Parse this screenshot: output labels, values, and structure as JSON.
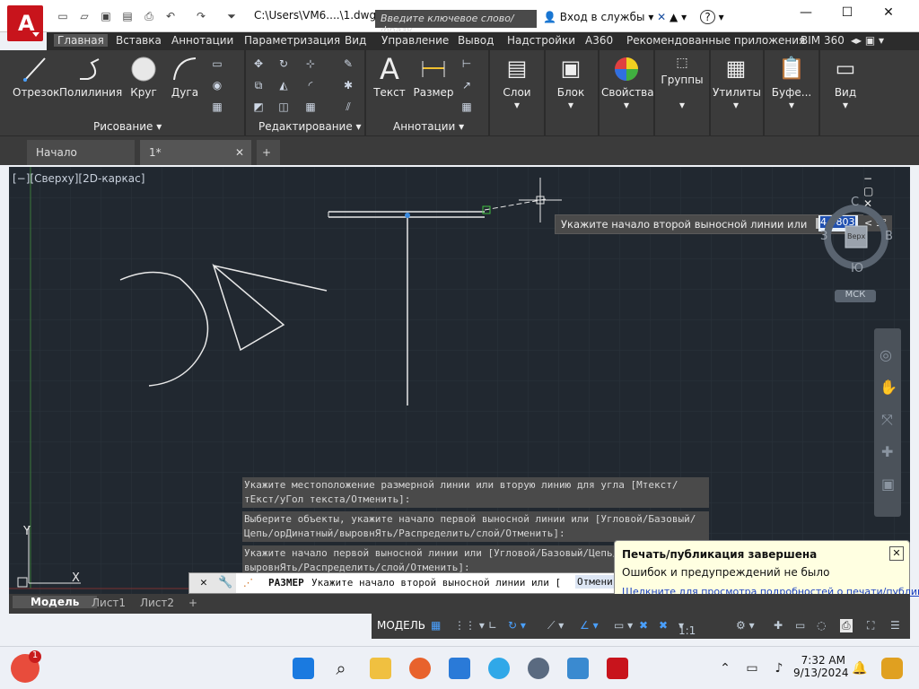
{
  "title_bar": {
    "doc_path": "C:\\Users\\VM6....\\1.dwg",
    "search_placeholder": "Введите ключевое слово/фразу",
    "services_label": "Вход в службы",
    "help_label": "?",
    "minimize": "—",
    "maximize": "☐",
    "close": "✕"
  },
  "ribbon_tabs": [
    "Главная",
    "Вставка",
    "Аннотации",
    "Параметризация",
    "Вид",
    "Управление",
    "Вывод",
    "Надстройки",
    "A360",
    "Рекомендованные приложения",
    "BIM 360"
  ],
  "ribbon": {
    "draw_buttons": [
      "Отрезок",
      "Полилиния",
      "Круг",
      "Дуга"
    ],
    "draw_panel": "Рисование",
    "modify_panel": "Редактирование",
    "annot_buttons": [
      "Текст",
      "Размер"
    ],
    "annot_panel": "Аннотации",
    "big_buttons": [
      "Слои",
      "Блок",
      "Свойства",
      "Группы",
      "Утилиты",
      "Буфе...",
      "Вид"
    ]
  },
  "file_tabs": {
    "start": "Начало",
    "doc": "1*",
    "add": "+"
  },
  "viewport": {
    "label": "[−][Сверху][2D-каркас]",
    "controls": "− ▢ ✕",
    "prompt_tooltip": "Укажите начало второй выносной линии или",
    "dyn_value": "4.9803",
    "dyn_angle": "< 9°",
    "viewcube": {
      "n": "С",
      "s": "Ю",
      "w": "З",
      "e": "В",
      "top": "Верх",
      "ucs": "МСК"
    }
  },
  "command_history": [
    "Укажите местоположение размерной линии или вторую линию для угла [Мтекст/тЕкст/уГол текста/Отменить]:",
    "Выберите объекты, укажите начало первой выносной линии или [Угловой/Базовый/Цепь/орДинатный/выровнЯть/Распределить/слой/Отменить]:",
    "Укажите начало первой выносной линии или [Угловой/Базовый/Цепь/орДинатный/выровнЯть/Распределить/слой/Отменить]:"
  ],
  "command_line": {
    "prefix": "РАЗМЕР",
    "text": "Укажите начало второй выносной линии или [",
    "option": "Отменить",
    "suffix": "]:"
  },
  "layout_tabs": [
    "Модель",
    "Лист1",
    "Лист2",
    "+"
  ],
  "statusbar": {
    "model": "МОДЕЛЬ",
    "scale": "1:1"
  },
  "notification": {
    "title": "Печать/публикация завершена",
    "line1": "Ошибок и предупреждений не было",
    "link": "Щелкните для просмотра подробностей о печати/публикации..."
  },
  "taskbar": {
    "time": "7:32 AM",
    "date": "9/13/2024",
    "badge": "1"
  },
  "colors": {
    "canvas": "#212830",
    "ribbon": "#3b3b3b",
    "accent": "#c8141c"
  }
}
